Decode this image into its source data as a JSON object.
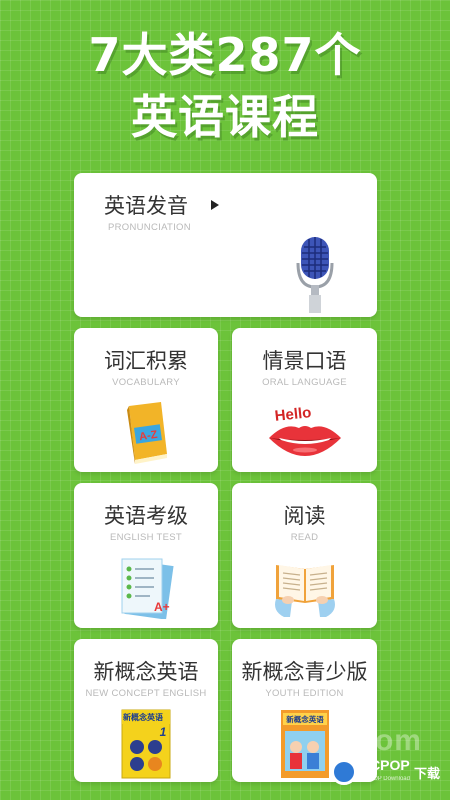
{
  "headline": {
    "line1": "7大类287个",
    "line2": "英语课程"
  },
  "courses": [
    {
      "title": "英语发音",
      "subtitle": "PRONUNCIATION",
      "icon": "microphone-icon"
    },
    {
      "title": "词汇积累",
      "subtitle": "VOCABULARY",
      "icon": "dictionary-book-icon",
      "book_label": "A-Z"
    },
    {
      "title": "情景口语",
      "subtitle": "ORAL LANGUAGE",
      "icon": "lips-icon",
      "speech_label": "Hello"
    },
    {
      "title": "英语考级",
      "subtitle": "ENGLISH TEST",
      "icon": "test-paper-icon",
      "grade_label": "A+"
    },
    {
      "title": "阅读",
      "subtitle": "READ",
      "icon": "open-book-icon"
    },
    {
      "title": "新概念英语",
      "subtitle": "NEW CONCEPT ENGLISH",
      "icon": "new-concept-book-icon",
      "book_title": "新概念英语",
      "book_number": "1"
    },
    {
      "title": "新概念青少版",
      "subtitle": "YOUTH EDITION",
      "icon": "youth-edition-book-icon",
      "book_title": "新概念英语"
    }
  ],
  "watermark": {
    "ghost": "1.com",
    "brand": "PCPOP",
    "brand_sub": "PCPOP Download",
    "right": "下载"
  },
  "colors": {
    "background": "#6cc33a",
    "card": "#ffffff",
    "title": "#333333",
    "subtitle": "#b9b9b9"
  }
}
